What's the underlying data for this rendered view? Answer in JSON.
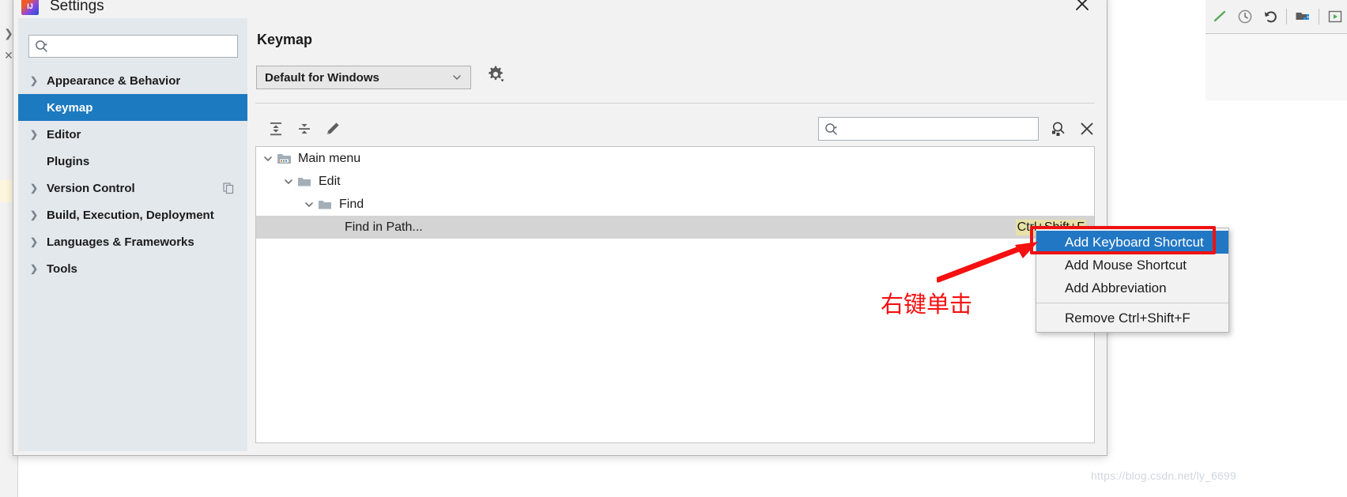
{
  "dialog": {
    "title": "Settings",
    "app_icon": "intellij-idea-icon",
    "close_label": "✕"
  },
  "sidebar": {
    "search": {
      "value": "",
      "placeholder": ""
    },
    "items": [
      {
        "label": "Appearance & Behavior",
        "expandable": true,
        "selected": false
      },
      {
        "label": "Keymap",
        "expandable": false,
        "selected": true
      },
      {
        "label": "Editor",
        "expandable": true,
        "selected": false
      },
      {
        "label": "Plugins",
        "expandable": false,
        "selected": false
      },
      {
        "label": "Version Control",
        "expandable": true,
        "selected": false,
        "trailing_icon": "copy-icon"
      },
      {
        "label": "Build, Execution, Deployment",
        "expandable": true,
        "selected": false
      },
      {
        "label": "Languages & Frameworks",
        "expandable": true,
        "selected": false
      },
      {
        "label": "Tools",
        "expandable": true,
        "selected": false
      }
    ]
  },
  "pane": {
    "title": "Keymap",
    "keymap_select": {
      "value": "Default for Windows",
      "options": [
        "Default for Windows"
      ]
    },
    "gear_label": "gear-icon",
    "toolbar": {
      "expand_all": "expand-all-icon",
      "collapse_all": "collapse-all-icon",
      "edit": "edit-pencil-icon",
      "search": {
        "value": "",
        "placeholder": ""
      },
      "filter_shortcut": "filter-by-shortcut-icon",
      "clear": "clear-icon"
    },
    "tree": [
      {
        "label": "Main menu",
        "depth": 0,
        "icon": "main-menu-icon",
        "expanded": true,
        "selected": false,
        "shortcut": ""
      },
      {
        "label": "Edit",
        "depth": 1,
        "icon": "folder-icon",
        "expanded": true,
        "selected": false,
        "shortcut": ""
      },
      {
        "label": "Find",
        "depth": 2,
        "icon": "folder-icon",
        "expanded": true,
        "selected": false,
        "shortcut": ""
      },
      {
        "label": "Find in Path...",
        "depth": 3,
        "icon": "none",
        "expanded": false,
        "selected": true,
        "shortcut": "Ctrl+Shift+F"
      }
    ]
  },
  "context_menu": {
    "items": [
      {
        "label": "Add Keyboard Shortcut",
        "active": true,
        "separator_before": false
      },
      {
        "label": "Add Mouse Shortcut",
        "active": false,
        "separator_before": false
      },
      {
        "label": "Add Abbreviation",
        "active": false,
        "separator_before": false
      },
      {
        "label": "Remove Ctrl+Shift+F",
        "active": false,
        "separator_before": true
      }
    ]
  },
  "annotations": {
    "callout_text": "右键单击",
    "highlight_color": "#ee1111",
    "arrow_name": "red-arrow"
  },
  "background_ide": {
    "toolbar_icons": [
      "check-icon",
      "clock-icon",
      "undo-icon",
      "folder-project-icon",
      "run-icon"
    ],
    "watermark": "https://blog.csdn.net/ly_6699"
  },
  "colors": {
    "accent_blue": "#1c7ac0",
    "menu_highlight": "#2277c4",
    "shortcut_highlight": "#e8e2a8",
    "selection_gray": "#d4d4d4",
    "annotation_red": "#ee1111"
  }
}
